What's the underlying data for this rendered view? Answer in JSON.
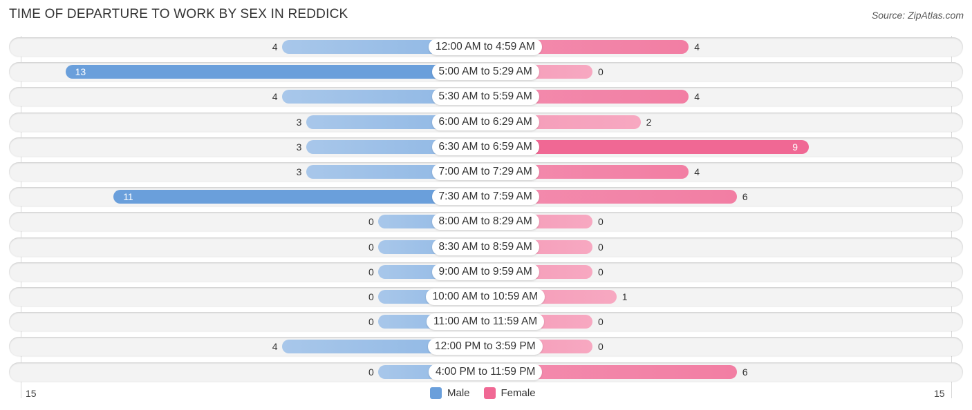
{
  "header": {
    "title": "TIME OF DEPARTURE TO WORK BY SEX IN REDDICK",
    "source": "Source: ZipAtlas.com"
  },
  "colors": {
    "male": "#6a9fdb",
    "female": "#f06894"
  },
  "chart_data": {
    "type": "bar",
    "orientation": "horizontal-diverging",
    "title": "TIME OF DEPARTURE TO WORK BY SEX IN REDDICK",
    "categories": [
      "12:00 AM to 4:59 AM",
      "5:00 AM to 5:29 AM",
      "5:30 AM to 5:59 AM",
      "6:00 AM to 6:29 AM",
      "6:30 AM to 6:59 AM",
      "7:00 AM to 7:29 AM",
      "7:30 AM to 7:59 AM",
      "8:00 AM to 8:29 AM",
      "8:30 AM to 8:59 AM",
      "9:00 AM to 9:59 AM",
      "10:00 AM to 10:59 AM",
      "11:00 AM to 11:59 AM",
      "12:00 PM to 3:59 PM",
      "4:00 PM to 11:59 PM"
    ],
    "series": [
      {
        "name": "Male",
        "values": [
          4,
          13,
          4,
          3,
          3,
          3,
          11,
          0,
          0,
          0,
          0,
          0,
          4,
          0
        ]
      },
      {
        "name": "Female",
        "values": [
          4,
          0,
          4,
          2,
          9,
          4,
          6,
          0,
          0,
          0,
          1,
          0,
          0,
          6
        ]
      }
    ],
    "axis": {
      "left_tick": "15",
      "right_tick": "15",
      "range": [
        -15,
        15
      ]
    },
    "legend": {
      "position": "bottom-center",
      "entries": [
        "Male",
        "Female"
      ]
    },
    "grid": false
  }
}
